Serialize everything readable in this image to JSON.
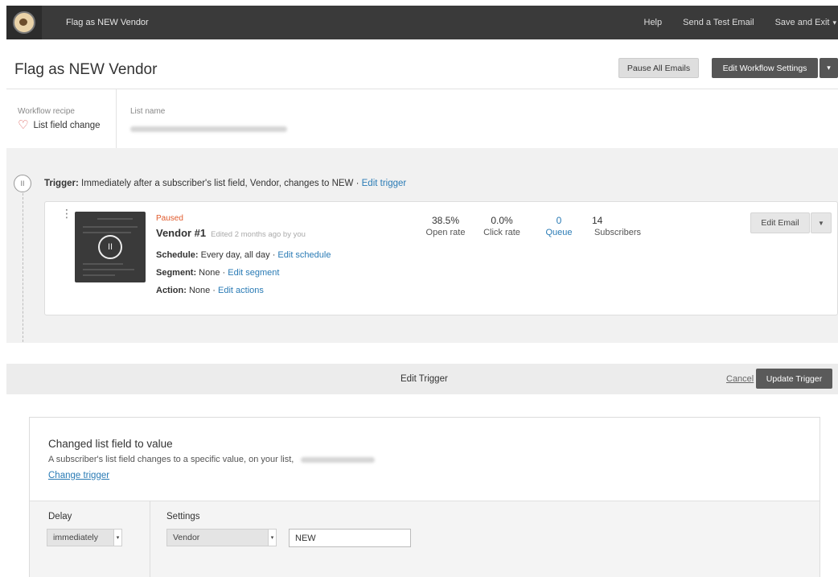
{
  "topbar": {
    "title": "Flag as NEW Vendor",
    "help": "Help",
    "send_test": "Send a Test Email",
    "save_exit": "Save and Exit"
  },
  "header": {
    "title": "Flag as NEW Vendor",
    "pause_all": "Pause All Emails",
    "edit_workflow": "Edit Workflow Settings"
  },
  "recipe": {
    "label": "Workflow recipe",
    "value": "List field change",
    "list_label": "List name"
  },
  "trigger": {
    "prefix": "Trigger:",
    "text": " Immediately after a subscriber's list field, Vendor, changes to NEW · ",
    "edit_link": "Edit trigger"
  },
  "email": {
    "status": "Paused",
    "name": "Vendor #1",
    "edited": "Edited 2 months ago by you",
    "schedule_label": "Schedule:",
    "schedule_value": " Every day, all day · ",
    "schedule_link": "Edit schedule",
    "segment_label": "Segment:",
    "segment_value": " None · ",
    "segment_link": "Edit segment",
    "action_label": "Action:",
    "action_value": " None · ",
    "action_link": "Edit actions",
    "stats": [
      {
        "value": "38.5%",
        "label": "Open rate"
      },
      {
        "value": "0.0%",
        "label": "Click rate"
      },
      {
        "value": "0",
        "label": "Queue"
      },
      {
        "value": "14",
        "label": "Subscribers"
      }
    ],
    "edit_button": "Edit Email"
  },
  "edit_trigger": {
    "title": "Edit Trigger",
    "cancel": "Cancel",
    "update": "Update Trigger"
  },
  "trigger_panel": {
    "title": "Changed list field to value",
    "description": "A subscriber's list field changes to a specific value, on your list,",
    "change_link": "Change trigger",
    "delay_label": "Delay",
    "delay_value": "immediately",
    "settings_label": "Settings",
    "field_value": "Vendor",
    "input_value": "NEW"
  }
}
